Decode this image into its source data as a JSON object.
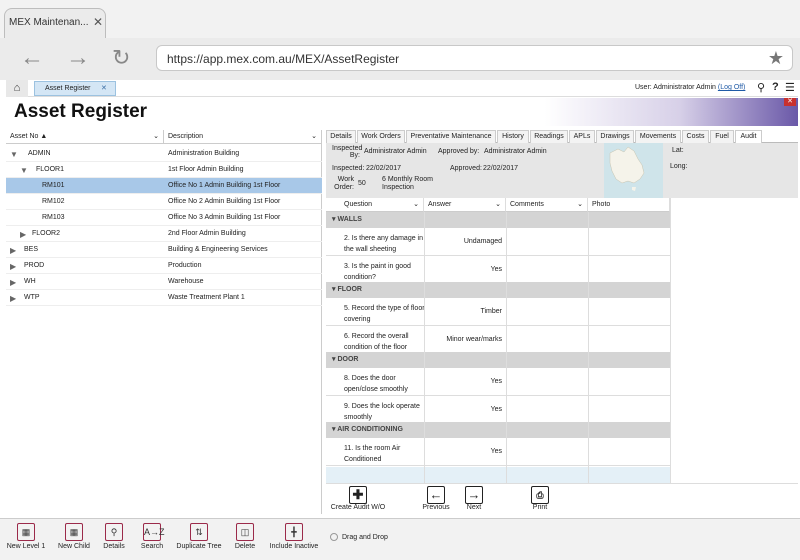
{
  "browser": {
    "tab_title": "MEX Maintenan...",
    "tab_close": "✕",
    "url": "https://app.mex.com.au/MEX/AssetRegister",
    "back_icon": "arrow-left-icon",
    "forward_icon": "arrow-right-icon",
    "reload_icon": "reload-icon",
    "star_icon": "star-icon"
  },
  "app": {
    "breadcrumb": "Asset Register",
    "breadcrumb_close": "✕",
    "user_text": "User: Administrator Admin",
    "logoff": "(Log Off)",
    "page_title": "Asset Register",
    "close_label": "✕"
  },
  "tree": {
    "col_asset": "Asset No",
    "col_desc": "Description",
    "rows": [
      {
        "asset": "ADMIN",
        "desc": "Administration Building"
      },
      {
        "asset": "FLOOR1",
        "desc": "1st Floor Admin Building"
      },
      {
        "asset": "RM101",
        "desc": "Office No 1 Admin Building 1st Floor"
      },
      {
        "asset": "RM102",
        "desc": "Office No 2 Admin Building 1st Floor"
      },
      {
        "asset": "RM103",
        "desc": "Office No 3 Admin Building 1st Floor"
      },
      {
        "asset": "FLOOR2",
        "desc": "2nd Floor Admin Building"
      },
      {
        "asset": "BES",
        "desc": "Building & Engineering Services"
      },
      {
        "asset": "PROD",
        "desc": "Production"
      },
      {
        "asset": "WH",
        "desc": "Warehouse"
      },
      {
        "asset": "WTP",
        "desc": "Waste Treatment Plant 1"
      }
    ]
  },
  "tabs": [
    "Details",
    "Work Orders",
    "Preventative Maintenance",
    "History",
    "Readings",
    "APLs",
    "Drawings",
    "Movements",
    "Costs",
    "Fuel",
    "Audit"
  ],
  "inspection": {
    "inspected_by_label": "Inspected By:",
    "inspected_by": "Administrator Admin",
    "approved_by_label": "Approved by:",
    "approved_by": "Administrator Admin",
    "inspected_label": "Inspected:",
    "inspected_date": "22/02/2017",
    "approved_label": "Approved:",
    "approved_date": "22/02/2017",
    "wo_label": "Work Order:",
    "wo_number": "50",
    "wo_desc": "6 Monthly Room Inspection",
    "lat_label": "Lat:",
    "long_label": "Long:"
  },
  "audit_columns": [
    "Question",
    "Answer",
    "Comments",
    "Photo"
  ],
  "sections": [
    {
      "name": "WALLS",
      "questions": [
        {
          "q": "2. Is there any damage in the wall sheeting",
          "a": "Undamaged"
        },
        {
          "q": "3. Is the paint in good condition?",
          "a": "Yes"
        }
      ]
    },
    {
      "name": "FLOOR",
      "questions": [
        {
          "q": "5. Record the type of floor covering",
          "a": "Timber"
        },
        {
          "q": "6. Record the overall condition of the floor",
          "a": "Minor wear/marks"
        }
      ]
    },
    {
      "name": "DOOR",
      "questions": [
        {
          "q": "8. Does the door open/close smoothly",
          "a": "Yes"
        },
        {
          "q": "9. Does the lock operate smoothly",
          "a": "Yes"
        }
      ]
    },
    {
      "name": "AIR CONDITIONING",
      "questions": [
        {
          "q": "11. Is the room Air Conditioned",
          "a": "Yes"
        }
      ]
    }
  ],
  "actions": {
    "create": "Create Audit W/O",
    "previous": "Previous",
    "next": "Next",
    "print": "Print"
  },
  "bottom": {
    "new_level1": "New Level 1",
    "new_child": "New Child",
    "details": "Details",
    "search": "Search",
    "duplicate": "Duplicate Tree",
    "delete": "Delete",
    "include_inactive": "Include Inactive",
    "drag_drop": "Drag and Drop",
    "az": "A→Z"
  },
  "colors": {
    "selected_row": "#a8c8e8",
    "accent": "#6a58a8",
    "close_red": "#c8312f"
  }
}
